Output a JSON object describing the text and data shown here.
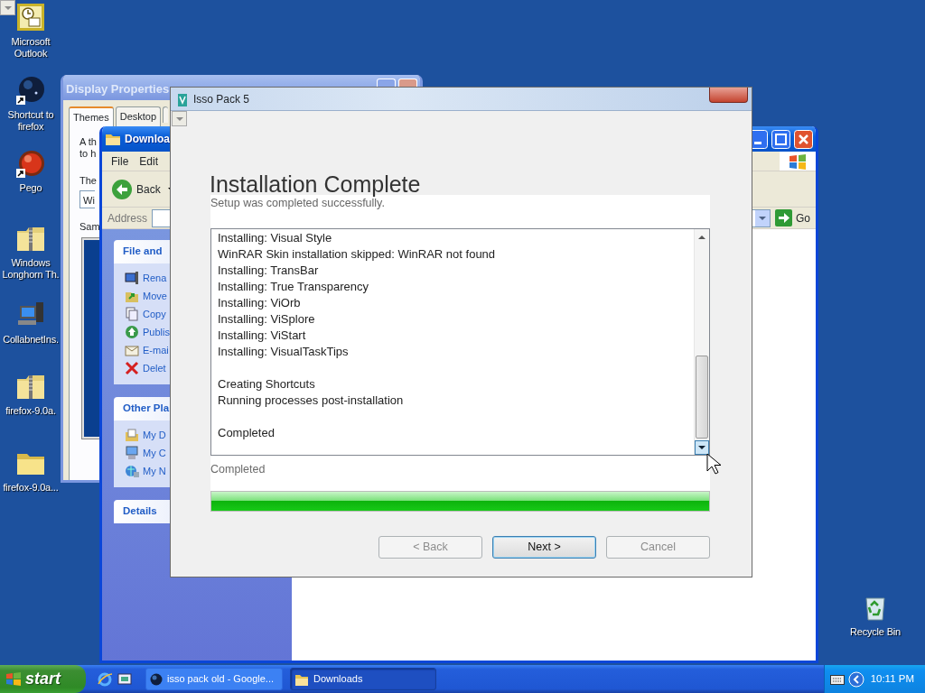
{
  "desktop_icons": [
    {
      "kind": "outlook",
      "label": "Microsoft Outlook"
    },
    {
      "kind": "globe_shortcut",
      "label": "Shortcut to firefox"
    },
    {
      "kind": "ball_shortcut",
      "label": "Pego"
    },
    {
      "kind": "zip",
      "label": "Windows Longhorn Th."
    },
    {
      "kind": "computer",
      "label": "CollabnetIns."
    },
    {
      "kind": "zip",
      "label": "firefox-9.0a."
    },
    {
      "kind": "folder",
      "label": "firefox-9.0a..."
    }
  ],
  "recycle_bin": {
    "label": "Recycle Bin"
  },
  "display_properties": {
    "title": "Display Properties",
    "tabs": [
      {
        "label": "Themes",
        "selected": true
      },
      {
        "label": "Desktop",
        "selected": false
      },
      {
        "selected": false
      }
    ],
    "description": [
      "A th",
      "to h"
    ],
    "theme_label": "The",
    "theme_value": "Wi",
    "sample_label": "Sam"
  },
  "explorer": {
    "title": "Downloa",
    "menu": [
      "File",
      "Edit"
    ],
    "back_button": "Back",
    "address_label": "Address",
    "go_button": "Go",
    "task_panels": [
      {
        "title": "File and",
        "items": [
          {
            "kind": "rename",
            "label": "Rena"
          },
          {
            "kind": "move",
            "label": "Move"
          },
          {
            "kind": "copy",
            "label": "Copy"
          },
          {
            "kind": "publish",
            "label": "Publis"
          },
          {
            "kind": "email",
            "label": "E-mai"
          },
          {
            "kind": "delete",
            "label": "Delet"
          }
        ]
      },
      {
        "title": "Other Pla",
        "items": [
          {
            "kind": "documents",
            "label": "My D"
          },
          {
            "kind": "computer",
            "label": "My C"
          },
          {
            "kind": "network",
            "label": "My N"
          }
        ]
      },
      {
        "title": "Details"
      }
    ]
  },
  "installer": {
    "title": "Isso Pack 5",
    "heading": "Installation Complete",
    "subtitle": "Setup was completed successfully.",
    "log": [
      {
        "lines": [
          "Installing: Visual Style",
          "WinRAR Skin installation skipped: WinRAR not found",
          "Installing: TransBar",
          "Installing: True Transparency",
          "Installing: ViOrb",
          "Installing: ViSplore",
          "Installing: ViStart",
          "Installing: VisualTaskTips"
        ]
      },
      {
        "lines": [
          "Creating Shortcuts",
          "Running processes post-installation"
        ]
      },
      {
        "lines": [
          "Completed"
        ]
      }
    ],
    "status": "Completed",
    "progress": {
      "level": 1
    },
    "buttons": [
      {
        "label": "< Back",
        "disabled": true
      },
      {
        "label": "Next >",
        "disabled": false
      },
      {
        "label": "Cancel",
        "disabled": true
      }
    ]
  },
  "taskbar": {
    "start": "start",
    "tasks": [
      {
        "kind": "browser",
        "label": "isso pack old - Google...",
        "selected": false
      },
      {
        "kind": "folder",
        "label": "Downloads",
        "selected": true
      }
    ],
    "clock": "10:11 PM"
  }
}
